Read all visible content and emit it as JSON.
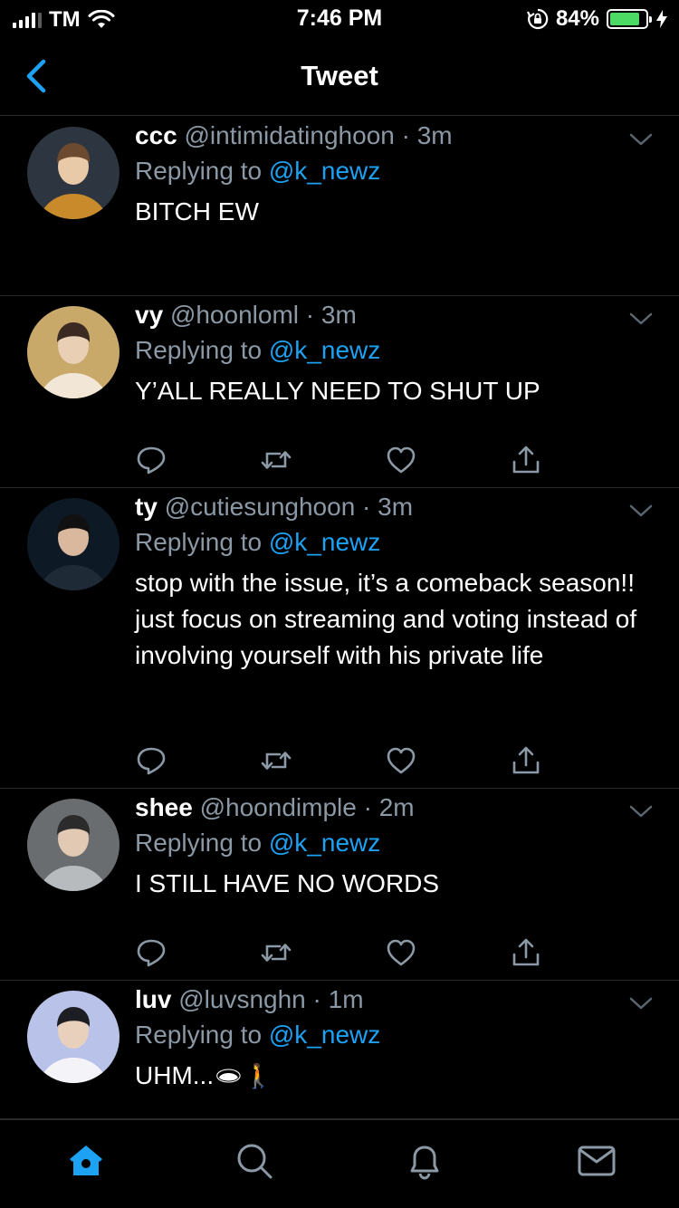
{
  "status_bar": {
    "carrier": "TM",
    "time": "7:46 PM",
    "battery_percent": "84%",
    "battery_level": 0.84,
    "signal_bars": 4,
    "icons": [
      "signal-icon",
      "wifi-icon",
      "orientation-lock-icon",
      "battery-icon",
      "charging-bolt-icon"
    ]
  },
  "header": {
    "title": "Tweet",
    "back_icon": "back-chevron-icon"
  },
  "colors": {
    "background": "#000000",
    "accent": "#1da1f2",
    "secondary_text": "#8b98a5",
    "divider": "#2a2a2a",
    "battery": "#4cd964"
  },
  "tweets": [
    {
      "name": "ccc",
      "handle": "@intimidatinghoon",
      "sep": "·",
      "time": "3m",
      "replying_prefix": "Replying to",
      "replying_to": "@k_newz",
      "text": "BITCH EW",
      "emoji": ""
    },
    {
      "name": "vy",
      "handle": "@hoonloml",
      "sep": "·",
      "time": "3m",
      "replying_prefix": "Replying to",
      "replying_to": "@k_newz",
      "text": "Y’ALL REALLY NEED TO SHUT UP",
      "emoji": ""
    },
    {
      "name": "ty",
      "handle": "@cutiesunghoon",
      "sep": "·",
      "time": "3m",
      "replying_prefix": "Replying to",
      "replying_to": "@k_newz",
      "text": "stop with the issue, it’s a comeback season!! just focus on streaming and voting instead of involving yourself with his private life",
      "emoji": ""
    },
    {
      "name": "shee",
      "handle": "@hoondimple",
      "sep": "·",
      "time": "2m",
      "replying_prefix": "Replying to",
      "replying_to": "@k_newz",
      "text": "I STILL HAVE NO WORDS",
      "emoji": ""
    },
    {
      "name": "luv",
      "handle": "@luvsnghn",
      "sep": "·",
      "time": "1m",
      "replying_prefix": "Replying to",
      "replying_to": "@k_newz",
      "text": "UHM...",
      "emoji": "🕳🚶"
    }
  ],
  "tweet_actions": [
    "reply-icon",
    "retweet-icon",
    "like-icon",
    "share-icon"
  ],
  "tabbar": {
    "tabs": [
      "home-icon",
      "search-icon",
      "notifications-icon",
      "messages-icon"
    ],
    "active_tab": "home"
  }
}
